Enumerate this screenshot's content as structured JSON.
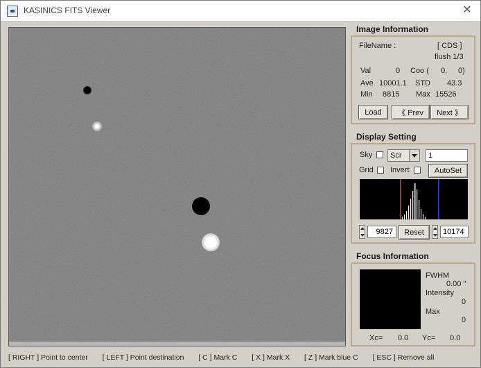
{
  "window": {
    "title": "KASINICS FITS Viewer",
    "close_glyph": "✕"
  },
  "image_info": {
    "title": "Image Information",
    "filename_label": "FileName :",
    "filename_value": "[ CDS ]",
    "frame": "flush 1/3",
    "val_label": "Val",
    "val_value": "0",
    "coo_label": "Coo (",
    "coo_x": "0,",
    "coo_y": "0)",
    "ave_label": "Ave",
    "ave_value": "10001.1",
    "std_label": "STD",
    "std_value": "43.3",
    "min_label": "Min",
    "min_value": "8815",
    "max_label": "Max",
    "max_value": "15526",
    "load_button": "Load",
    "prev_button": "《 Prev",
    "next_button": "Next 》"
  },
  "display_setting": {
    "title": "Display Setting",
    "sky_label": "Sky",
    "scale_select": "Scr",
    "scale_value": "1",
    "grid_label": "Grid",
    "invert_label": "Invert",
    "autoset_button": "AutoSet",
    "low_value": "9827",
    "reset_button": "Reset",
    "high_value": "10174"
  },
  "focus_info": {
    "title": "Focus Information",
    "fwhm_label": "FWHM",
    "fwhm_value": "0.00 \"",
    "intensity_label": "Intensity",
    "intensity_value": "0",
    "max_label": "Max",
    "max_value": "0",
    "xc_label": "Xc=",
    "xc_value": "0.0",
    "yc_label": "Yc=",
    "yc_value": "0.0"
  },
  "statusbar": [
    "[ RIGHT ] Point to center",
    "[ LEFT ] Point destination",
    "[ C ] Mark C",
    "[ X ] Mark X",
    "[ Z ] Mark blue C",
    "[ ESC ] Remove all"
  ],
  "colors": {
    "histogram_low_marker": "#c0461e",
    "histogram_high_marker": "#2a44e0",
    "panel_border": "#b7a98a"
  },
  "icons": {
    "app": "app-window-icon",
    "close": "close-icon",
    "dropdown": "dropdown-arrow-icon"
  }
}
